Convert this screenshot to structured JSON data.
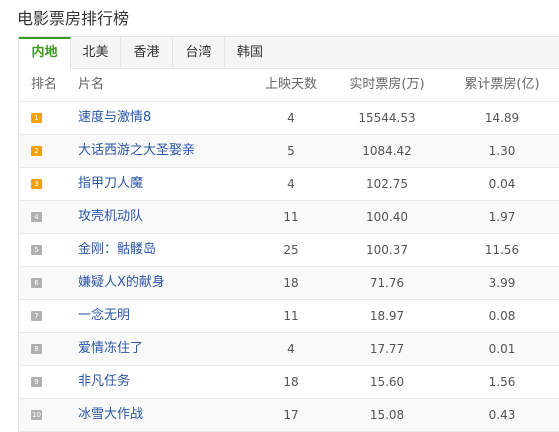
{
  "page_title": "电影票房排行榜",
  "tabs": [
    {
      "label": "内地",
      "active": true
    },
    {
      "label": "北美",
      "active": false
    },
    {
      "label": "香港",
      "active": false
    },
    {
      "label": "台湾",
      "active": false
    },
    {
      "label": "韩国",
      "active": false
    }
  ],
  "columns": {
    "rank": "排名",
    "name": "片名",
    "days": "上映天数",
    "realtime": "实时票房(万)",
    "total": "累计票房(亿)"
  },
  "colors": {
    "accent": "#3a9a1d",
    "badge_top": "#f5a20a",
    "badge_other": "#b0b0b0",
    "link": "#2c57a7"
  },
  "rows": [
    {
      "rank": "1",
      "name": "速度与激情8",
      "days": "4",
      "realtime": "15544.53",
      "total": "14.89"
    },
    {
      "rank": "2",
      "name": "大话西游之大圣娶亲",
      "days": "5",
      "realtime": "1084.42",
      "total": "1.30"
    },
    {
      "rank": "3",
      "name": "指甲刀人魔",
      "days": "4",
      "realtime": "102.75",
      "total": "0.04"
    },
    {
      "rank": "4",
      "name": "攻壳机动队",
      "days": "11",
      "realtime": "100.40",
      "total": "1.97"
    },
    {
      "rank": "5",
      "name": "金刚：骷髅岛",
      "days": "25",
      "realtime": "100.37",
      "total": "11.56"
    },
    {
      "rank": "6",
      "name": "嫌疑人X的献身",
      "days": "18",
      "realtime": "71.76",
      "total": "3.99"
    },
    {
      "rank": "7",
      "name": "一念无明",
      "days": "11",
      "realtime": "18.97",
      "total": "0.08"
    },
    {
      "rank": "8",
      "name": "爱情冻住了",
      "days": "4",
      "realtime": "17.77",
      "total": "0.01"
    },
    {
      "rank": "9",
      "name": "非凡任务",
      "days": "18",
      "realtime": "15.60",
      "total": "1.56"
    },
    {
      "rank": "10",
      "name": "冰雪大作战",
      "days": "17",
      "realtime": "15.08",
      "total": "0.43"
    }
  ]
}
